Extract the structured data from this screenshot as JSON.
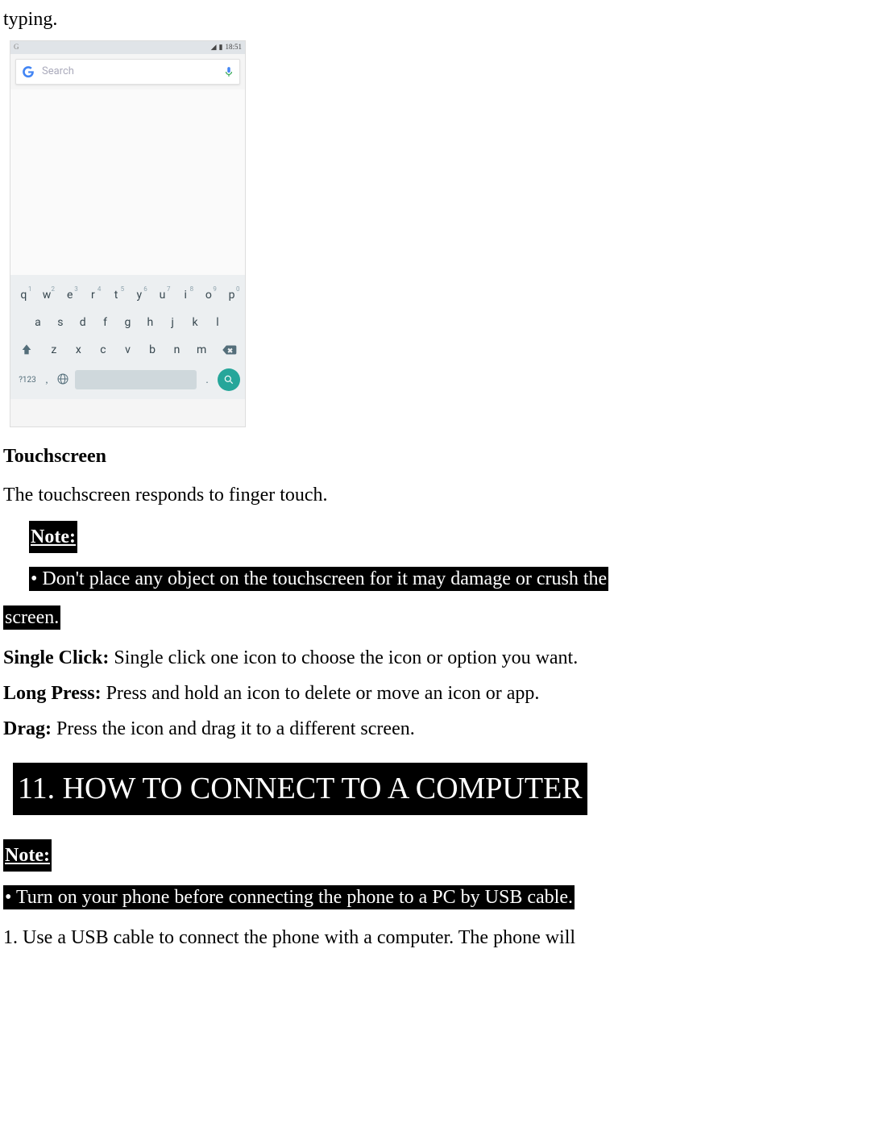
{
  "intro_fragment": "typing.",
  "screenshot": {
    "status_time": "18:51",
    "status_left": "G",
    "search_placeholder": "Search",
    "keyboard": {
      "row1": [
        {
          "k": "q",
          "n": "1"
        },
        {
          "k": "w",
          "n": "2"
        },
        {
          "k": "e",
          "n": "3"
        },
        {
          "k": "r",
          "n": "4"
        },
        {
          "k": "t",
          "n": "5"
        },
        {
          "k": "y",
          "n": "6"
        },
        {
          "k": "u",
          "n": "7"
        },
        {
          "k": "i",
          "n": "8"
        },
        {
          "k": "o",
          "n": "9"
        },
        {
          "k": "p",
          "n": "0"
        }
      ],
      "row2": [
        "a",
        "s",
        "d",
        "f",
        "g",
        "h",
        "j",
        "k",
        "l"
      ],
      "row3": [
        "z",
        "x",
        "c",
        "v",
        "b",
        "n",
        "m"
      ],
      "sym": "?123",
      "comma": ",",
      "period": "."
    }
  },
  "touchscreen_heading": "Touchscreen",
  "touchscreen_intro": "The touchscreen responds to finger touch.",
  "note1": {
    "label": "Note:",
    "line1": "• Don't place any object on the touchscreen for it may damage or crush the",
    "line2": "screen."
  },
  "defs": {
    "single_click_label": "Single Click:",
    "single_click_text": " Single click one icon to choose the icon or option you want.",
    "long_press_label": "Long Press:",
    "long_press_text": " Press and hold an icon to delete or move an icon or app.",
    "drag_label": "Drag:",
    "drag_text": " Press the icon and drag it to a different screen."
  },
  "chapter_heading": "11. HOW TO CONNECT TO A COMPUTER",
  "note2": {
    "label": "Note:",
    "line1": "• Turn on your phone before connecting the phone to a PC by USB cable."
  },
  "step1": "1. Use a USB cable to connect the phone with a computer. The phone will"
}
